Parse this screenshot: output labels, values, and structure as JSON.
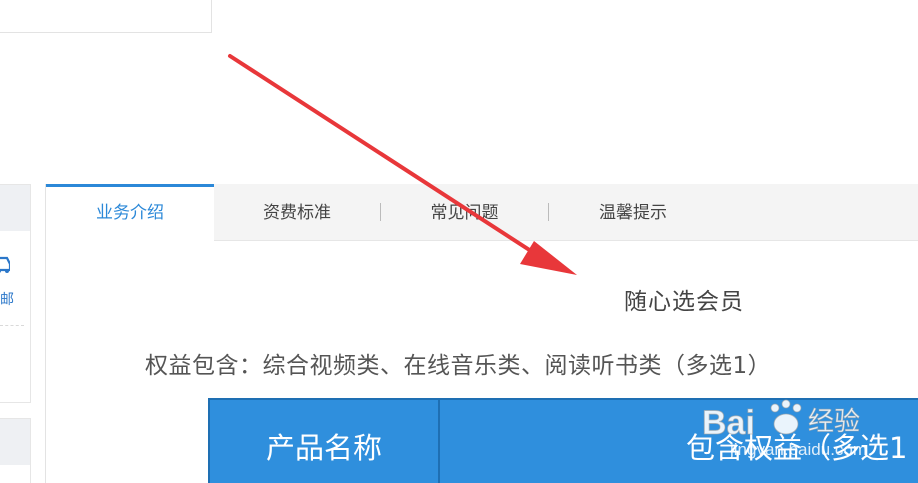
{
  "tabs": [
    {
      "label": "业务介绍",
      "active": true
    },
    {
      "label": "资费标准",
      "active": false
    },
    {
      "label": "常见问题",
      "active": false
    },
    {
      "label": "温馨提示",
      "active": false
    }
  ],
  "sidebar": {
    "item_label": "邮",
    "item_icon": "car-icon"
  },
  "main": {
    "heading": "随心选会员",
    "benefits": "权益包含：综合视频类、在线音乐类、阅读听书类（多选1）",
    "table": {
      "headers": [
        "产品名称",
        "包含权益（多选1"
      ]
    }
  },
  "watermark": {
    "brand": "Bai",
    "brand_suffix": "经验",
    "url": "jingyan.baidu.com"
  },
  "colors": {
    "accent": "#2b88d8",
    "table_header": "#2f8fdd",
    "annotation_arrow": "#e8373a"
  }
}
